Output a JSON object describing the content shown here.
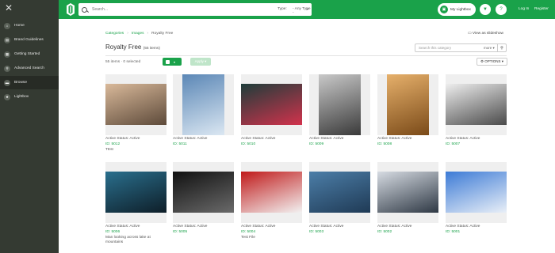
{
  "sidebar": {
    "items": [
      {
        "label": "Home",
        "icon": "home-icon",
        "glyph": "⌂",
        "active": false
      },
      {
        "label": "Brand Guidelines",
        "icon": "book-icon",
        "glyph": "▤",
        "active": false
      },
      {
        "label": "Getting Started",
        "icon": "grid-icon",
        "glyph": "▦",
        "active": false
      },
      {
        "label": "Advanced Search",
        "icon": "search-icon",
        "glyph": "⚲",
        "active": false
      },
      {
        "label": "Browse",
        "icon": "folder-icon",
        "glyph": "▬",
        "active": true
      },
      {
        "label": "Lightbox",
        "icon": "star-icon",
        "glyph": "★",
        "active": false
      }
    ]
  },
  "header": {
    "search_placeholder": "Search...",
    "type_label": "Type:",
    "type_value": "- Any Type -",
    "my_lightbox": "My Lightbox",
    "login": "Log In",
    "register": "Register",
    "accent": "#1aa24a"
  },
  "breadcrumb": {
    "items": [
      "Categories",
      "Images",
      "Royalty Free"
    ]
  },
  "slideshow_label": "View as slideshow",
  "page": {
    "title": "Royalty Free",
    "title_count": "(55 items)",
    "search_placeholder": "Search this category",
    "search_more": "more ▾",
    "counts": "55 items · 0 selected",
    "apply_label": "Apply ▾",
    "options_label": "OPTIONS ▾"
  },
  "items": [
    {
      "status": "Active Status: Active",
      "id": "ID: 5012",
      "caption": "TEst",
      "colors": [
        "#d9b99a",
        "#5d4a3a"
      ]
    },
    {
      "status": "Active Status: Active",
      "id": "ID: 5011",
      "caption": "",
      "colors": [
        "#5b87b6",
        "#dbe7f2"
      ]
    },
    {
      "status": "Active Status: Active",
      "id": "ID: 5010",
      "caption": "",
      "colors": [
        "#1e3d3a",
        "#d2324c"
      ]
    },
    {
      "status": "Active Status: Active",
      "id": "ID: 5009",
      "caption": "",
      "colors": [
        "#c9c9c9",
        "#3a3a3a"
      ]
    },
    {
      "status": "Active Status: Active",
      "id": "ID: 5008",
      "caption": "",
      "colors": [
        "#e6b06b",
        "#7a4a18"
      ]
    },
    {
      "status": "Active Status: Active",
      "id": "ID: 5007",
      "caption": "",
      "colors": [
        "#eeeeee",
        "#4a4a4a"
      ]
    },
    {
      "status": "Active Status: Active",
      "id": "ID: 5006",
      "caption": "Man looking across lake at mountains",
      "colors": [
        "#2a6f8d",
        "#0e1e28"
      ]
    },
    {
      "status": "Active Status: Active",
      "id": "ID: 5005",
      "caption": "",
      "colors": [
        "#111111",
        "#6a6a6a"
      ]
    },
    {
      "status": "Active Status: Active",
      "id": "ID: 5004",
      "caption": "Test File",
      "colors": [
        "#c01a1a",
        "#f2f2f2"
      ]
    },
    {
      "status": "Active Status: Active",
      "id": "ID: 5003",
      "caption": "",
      "colors": [
        "#4c7ea8",
        "#1f3a55"
      ]
    },
    {
      "status": "Active Status: Active",
      "id": "ID: 5002",
      "caption": "",
      "colors": [
        "#d6dbe2",
        "#2e3844"
      ]
    },
    {
      "status": "Active Status: Active",
      "id": "ID: 5001",
      "caption": "",
      "colors": [
        "#3d7bd6",
        "#e9eff7"
      ]
    }
  ]
}
